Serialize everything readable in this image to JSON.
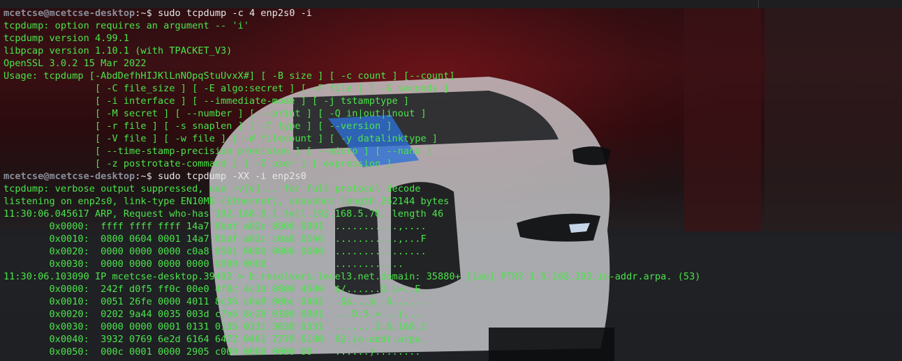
{
  "terminal": {
    "colors": {
      "output": "#4ae44a",
      "prompt_user": "#8a8f9a",
      "command": "#e8e8e8"
    },
    "lines": [
      {
        "type": "prompt",
        "user": "mcetcse@mcetcse-desktop",
        "path": ":~$",
        "cmd": " sudo tcpdump -c 4 enp2s0 -i"
      },
      {
        "type": "out",
        "text": "tcpdump: option requires an argument -- 'i'"
      },
      {
        "type": "out",
        "text": "tcpdump version 4.99.1"
      },
      {
        "type": "out",
        "text": "libpcap version 1.10.1 (with TPACKET_V3)"
      },
      {
        "type": "out",
        "text": "OpenSSL 3.0.2 15 Mar 2022"
      },
      {
        "type": "out",
        "text": "Usage: tcpdump [-AbdDefhHIJKlLnNOpqStuUvxX#] [ -B size ] [ -c count ] [--count]"
      },
      {
        "type": "out",
        "text": "                [ -C file_size ] [ -E algo:secret ] [ -F file ] [ -G seconds ]"
      },
      {
        "type": "out",
        "text": "                [ -i interface ] [ --immediate-mode ] [ -j tstamptype ]"
      },
      {
        "type": "out",
        "text": "                [ -M secret ] [ --number ] [ --print ] [ -Q in|out|inout ]"
      },
      {
        "type": "out",
        "text": "                [ -r file ] [ -s snaplen ] [ -T type ] [ --version ]"
      },
      {
        "type": "out",
        "text": "                [ -V file ] [ -w file ] [ -W filecount ] [ -y datalinktype ]"
      },
      {
        "type": "out",
        "text": "                [ --time-stamp-precision precision ] [ --micro ] [ --nano ]"
      },
      {
        "type": "out",
        "text": "                [ -z postrotate-command ] [ -Z user ] [ expression ]"
      },
      {
        "type": "prompt",
        "user": "mcetcse@mcetcse-desktop",
        "path": ":~$",
        "cmd": " sudo tcpdump -XX -i enp2s0"
      },
      {
        "type": "out",
        "text": "tcpdump: verbose output suppressed, use -v[v]... for full protocol decode"
      },
      {
        "type": "out",
        "text": "listening on enp2s0, link-type EN10MB (Ethernet), snapshot length 262144 bytes"
      },
      {
        "type": "out",
        "text": "11:30:06.045617 ARP, Request who-has 192.168.5.1 tell 192.168.5.70, length 46"
      },
      {
        "type": "out",
        "text": "        0x0000:  ffff ffff ffff 14a7 8bbf a02c 0806 0001  ...........,...."
      },
      {
        "type": "out",
        "text": "        0x0010:  0800 0604 0001 14a7 8bbf a02c c0a8 0546  ...........,...F"
      },
      {
        "type": "out",
        "text": "        0x0020:  0000 0000 0000 c0a8 0501 0000 0000 0000  ................"
      },
      {
        "type": "out",
        "text": "        0x0030:  0000 0000 0000 0000 0000 0000            ............"
      },
      {
        "type": "out",
        "text": "11:30:06.103090 IP mcetcse-desktop.39492 > b.resolvers.level3.net.domain: 35880+ [1au] PTR? 1.5.168.192.in-addr.arpa. (53)"
      },
      {
        "type": "out",
        "text": "        0x0000:  242f d0f5 ff0c 00e0 4f0c 4c3d 0800 4500  $/......O.L=..E."
      },
      {
        "type": "out",
        "text": "        0x0010:  0051 26fe 0000 4011 8c36 c0a8 00bc 0402  .Q&...@..6......"
      },
      {
        "type": "out",
        "text": "        0x0020:  0202 9a44 0035 003d c7b6 8c28 0100 0001  ...D.5.=...(...."
      },
      {
        "type": "out",
        "text": "        0x0030:  0000 0000 0001 0131 0135 0331 3638 0331  .......1.5.168.1"
      },
      {
        "type": "out",
        "text": "        0x0040:  3932 0769 6e2d 6164 6472 0461 7270 6100  92.in-addr.arpa."
      },
      {
        "type": "out",
        "text": "        0x0050:  000c 0001 0000 2905 c000 0000 0000 00    ......)........"
      }
    ]
  }
}
